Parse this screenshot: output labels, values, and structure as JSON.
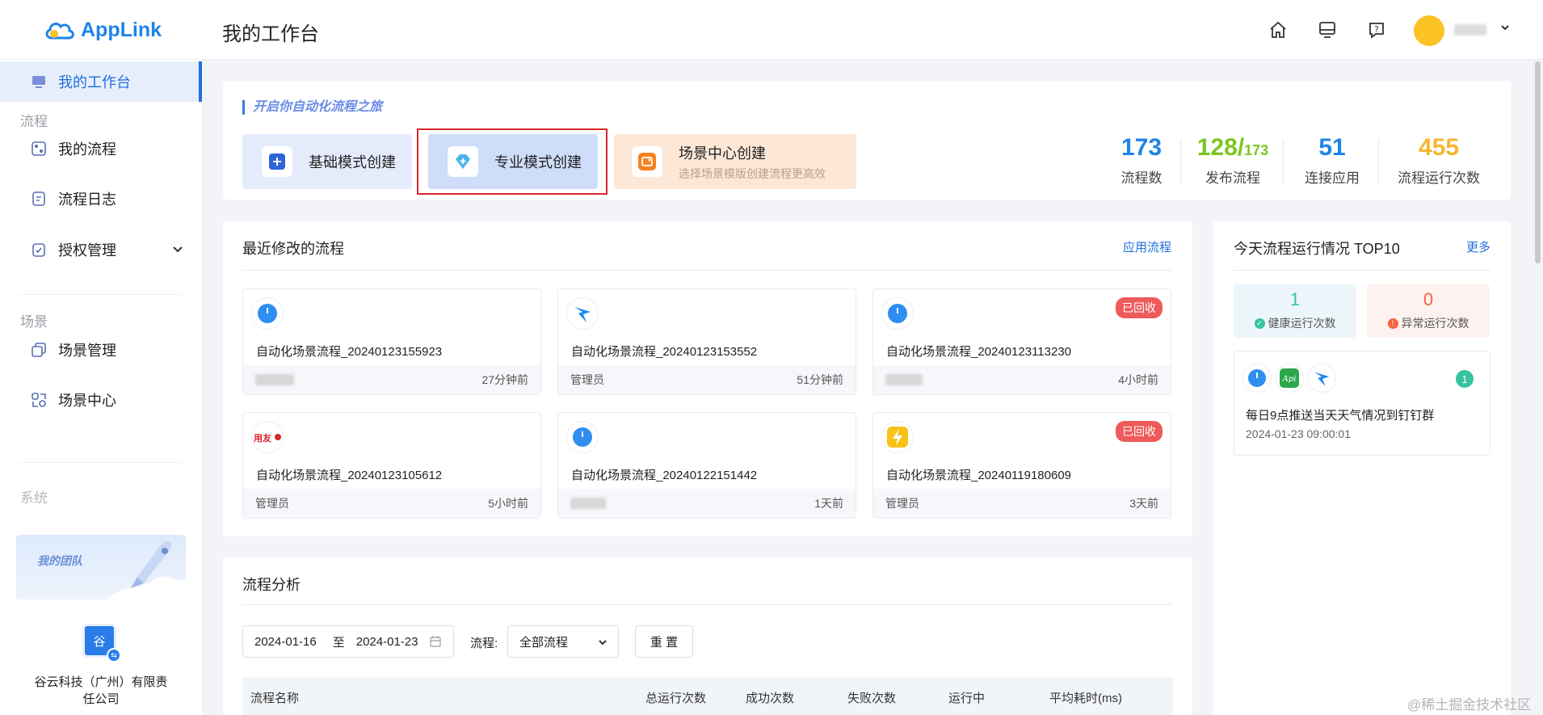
{
  "header": {
    "logo_text": "AppLink",
    "page_title": "我的工作台"
  },
  "sidebar": {
    "active_item": "我的工作台",
    "group_flow": "流程",
    "my_flows": "我的流程",
    "flow_logs": "流程日志",
    "auth_manage": "授权管理",
    "group_scene": "场景",
    "scene_manage": "场景管理",
    "scene_center": "场景中心",
    "group_system": "系统",
    "team_label": "我的团队",
    "team_avatar_char": "谷",
    "team_name": "谷云科技（广州）有限责任公司"
  },
  "create": {
    "banner": "开启你自动化流程之旅",
    "basic": "基础模式创建",
    "pro": "专业模式创建",
    "scene": "场景中心创建",
    "scene_sub": "选择场景模版创建流程更高效"
  },
  "stats": {
    "flows_value": "173",
    "flows_label": "流程数",
    "published_value": "128/",
    "published_total": "173",
    "published_label": "发布流程",
    "apps_value": "51",
    "apps_label": "连接应用",
    "runs_value": "455",
    "runs_label": "流程运行次数",
    "colors": {
      "flows": "#1f84e8",
      "published": "#7cc520",
      "apps": "#1f84e8",
      "runs": "#f7b731"
    }
  },
  "recent": {
    "title": "最近修改的流程",
    "link": "应用流程",
    "flows": [
      {
        "name": "自动化场景流程_20240123155923",
        "owner": "",
        "time": "27分钟前",
        "badge": "",
        "icon": "clock-icon"
      },
      {
        "name": "自动化场景流程_20240123153552",
        "owner": "管理员",
        "time": "51分钟前",
        "badge": "",
        "icon": "dingtalk-icon"
      },
      {
        "name": "自动化场景流程_20240123113230",
        "owner": "",
        "time": "4小时前",
        "badge": "已回收",
        "icon": "clock-icon"
      },
      {
        "name": "自动化场景流程_20240123105612",
        "owner": "管理员",
        "time": "5小时前",
        "badge": "",
        "icon": "yonyou-icon"
      },
      {
        "name": "自动化场景流程_20240122151442",
        "owner": "",
        "time": "1天前",
        "badge": "",
        "icon": "clock-icon"
      },
      {
        "name": "自动化场景流程_20240119180609",
        "owner": "管理员",
        "time": "3天前",
        "badge": "已回收",
        "icon": "lightning-icon"
      }
    ]
  },
  "top10": {
    "title": "今天流程运行情况 TOP10",
    "more": "更多",
    "healthy_value": "1",
    "healthy_label": "健康运行次数",
    "abnormal_value": "0",
    "abnormal_label": "异常运行次数",
    "run": {
      "count": "1",
      "name": "每日9点推送当天天气情况到钉钉群",
      "time": "2024-01-23 09:00:01",
      "icons": [
        "clock-icon",
        "api-icon",
        "dingtalk-icon"
      ]
    }
  },
  "analysis": {
    "title": "流程分析",
    "date_from": "2024-01-16",
    "date_sep": "至",
    "date_to": "2024-01-23",
    "flow_label": "流程:",
    "flow_select": "全部流程",
    "reset": "重 置",
    "columns": [
      "流程名称",
      "总运行次数",
      "成功次数",
      "失败次数",
      "运行中",
      "平均耗时(ms)"
    ]
  },
  "watermark": "@稀土掘金技术社区"
}
